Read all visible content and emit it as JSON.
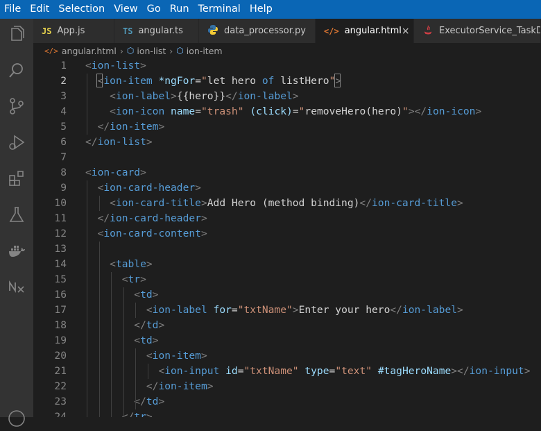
{
  "menu": [
    "File",
    "Edit",
    "Selection",
    "View",
    "Go",
    "Run",
    "Terminal",
    "Help"
  ],
  "tabs": [
    {
      "icon": "JS",
      "icon_color": "#e8d44d",
      "label": "App.js",
      "active": false
    },
    {
      "icon": "TS",
      "icon_color": "#519aba",
      "label": "angular.ts",
      "active": false
    },
    {
      "icon": "python-icon",
      "icon_color": "#3572a5",
      "label": "data_processor.py",
      "active": false
    },
    {
      "icon": "</>",
      "icon_color": "#e37933",
      "label": "angular.html",
      "active": true
    },
    {
      "icon": "java-icon",
      "icon_color": "#cc3e44",
      "label": "ExecutorService_TaskDepe",
      "active": false
    }
  ],
  "breadcrumb": [
    "angular.html",
    "ion-list",
    "ion-item"
  ],
  "editor": {
    "current_line": 2,
    "lines": [
      {
        "n": "1",
        "tokens": [
          [
            "p",
            "<"
          ],
          [
            "tag",
            "ion-list"
          ],
          [
            "p",
            ">"
          ]
        ]
      },
      {
        "n": "2",
        "tokens": [
          [
            "txt",
            "  "
          ],
          [
            "p",
            "<"
          ],
          [
            "tag",
            "ion-item"
          ],
          [
            "txt",
            " "
          ],
          [
            "attr",
            "*ngFor"
          ],
          [
            "txt",
            "="
          ],
          [
            "str",
            "\""
          ],
          [
            "txt",
            "let hero "
          ],
          [
            "tag",
            "of"
          ],
          [
            "txt",
            " listHero"
          ],
          [
            "str",
            "\""
          ],
          [
            "p",
            ">"
          ]
        ]
      },
      {
        "n": "3",
        "tokens": [
          [
            "txt",
            "    "
          ],
          [
            "p",
            "<"
          ],
          [
            "tag",
            "ion-label"
          ],
          [
            "p",
            ">"
          ],
          [
            "txt",
            "{{hero}}"
          ],
          [
            "p",
            "</"
          ],
          [
            "tag",
            "ion-label"
          ],
          [
            "p",
            ">"
          ]
        ]
      },
      {
        "n": "4",
        "tokens": [
          [
            "txt",
            "    "
          ],
          [
            "p",
            "<"
          ],
          [
            "tag",
            "ion-icon"
          ],
          [
            "txt",
            " "
          ],
          [
            "attr",
            "name"
          ],
          [
            "txt",
            "="
          ],
          [
            "str",
            "\"trash\""
          ],
          [
            "txt",
            " "
          ],
          [
            "attr",
            "(click)"
          ],
          [
            "txt",
            "="
          ],
          [
            "str",
            "\""
          ],
          [
            "txt",
            "removeHero(hero)"
          ],
          [
            "str",
            "\""
          ],
          [
            "p",
            "></"
          ],
          [
            "tag",
            "ion-icon"
          ],
          [
            "p",
            ">"
          ]
        ]
      },
      {
        "n": "5",
        "tokens": [
          [
            "txt",
            "  "
          ],
          [
            "p",
            "</"
          ],
          [
            "tag",
            "ion-item"
          ],
          [
            "p",
            ">"
          ]
        ]
      },
      {
        "n": "6",
        "tokens": [
          [
            "p",
            "</"
          ],
          [
            "tag",
            "ion-list"
          ],
          [
            "p",
            ">"
          ]
        ]
      },
      {
        "n": "7",
        "tokens": []
      },
      {
        "n": "8",
        "tokens": [
          [
            "p",
            "<"
          ],
          [
            "tag",
            "ion-card"
          ],
          [
            "p",
            ">"
          ]
        ]
      },
      {
        "n": "9",
        "tokens": [
          [
            "txt",
            "  "
          ],
          [
            "p",
            "<"
          ],
          [
            "tag",
            "ion-card-header"
          ],
          [
            "p",
            ">"
          ]
        ]
      },
      {
        "n": "10",
        "tokens": [
          [
            "txt",
            "    "
          ],
          [
            "p",
            "<"
          ],
          [
            "tag",
            "ion-card-title"
          ],
          [
            "p",
            ">"
          ],
          [
            "txt",
            "Add Hero (method binding)"
          ],
          [
            "p",
            "</"
          ],
          [
            "tag",
            "ion-card-title"
          ],
          [
            "p",
            ">"
          ]
        ]
      },
      {
        "n": "11",
        "tokens": [
          [
            "txt",
            "  "
          ],
          [
            "p",
            "</"
          ],
          [
            "tag",
            "ion-card-header"
          ],
          [
            "p",
            ">"
          ]
        ]
      },
      {
        "n": "12",
        "tokens": [
          [
            "txt",
            "  "
          ],
          [
            "p",
            "<"
          ],
          [
            "tag",
            "ion-card-content"
          ],
          [
            "p",
            ">"
          ]
        ]
      },
      {
        "n": "13",
        "tokens": []
      },
      {
        "n": "14",
        "tokens": [
          [
            "txt",
            "    "
          ],
          [
            "p",
            "<"
          ],
          [
            "tag",
            "table"
          ],
          [
            "p",
            ">"
          ]
        ]
      },
      {
        "n": "15",
        "tokens": [
          [
            "txt",
            "      "
          ],
          [
            "p",
            "<"
          ],
          [
            "tag",
            "tr"
          ],
          [
            "p",
            ">"
          ]
        ]
      },
      {
        "n": "16",
        "tokens": [
          [
            "txt",
            "        "
          ],
          [
            "p",
            "<"
          ],
          [
            "tag",
            "td"
          ],
          [
            "p",
            ">"
          ]
        ]
      },
      {
        "n": "17",
        "tokens": [
          [
            "txt",
            "          "
          ],
          [
            "p",
            "<"
          ],
          [
            "tag",
            "ion-label"
          ],
          [
            "txt",
            " "
          ],
          [
            "attr",
            "for"
          ],
          [
            "txt",
            "="
          ],
          [
            "str",
            "\"txtName\""
          ],
          [
            "p",
            ">"
          ],
          [
            "txt",
            "Enter your hero"
          ],
          [
            "p",
            "</"
          ],
          [
            "tag",
            "ion-label"
          ],
          [
            "p",
            ">"
          ]
        ]
      },
      {
        "n": "18",
        "tokens": [
          [
            "txt",
            "        "
          ],
          [
            "p",
            "</"
          ],
          [
            "tag",
            "td"
          ],
          [
            "p",
            ">"
          ]
        ]
      },
      {
        "n": "19",
        "tokens": [
          [
            "txt",
            "        "
          ],
          [
            "p",
            "<"
          ],
          [
            "tag",
            "td"
          ],
          [
            "p",
            ">"
          ]
        ]
      },
      {
        "n": "20",
        "tokens": [
          [
            "txt",
            "          "
          ],
          [
            "p",
            "<"
          ],
          [
            "tag",
            "ion-item"
          ],
          [
            "p",
            ">"
          ]
        ]
      },
      {
        "n": "21",
        "tokens": [
          [
            "txt",
            "            "
          ],
          [
            "p",
            "<"
          ],
          [
            "tag",
            "ion-input"
          ],
          [
            "txt",
            " "
          ],
          [
            "attr",
            "id"
          ],
          [
            "txt",
            "="
          ],
          [
            "str",
            "\"txtName\""
          ],
          [
            "txt",
            " "
          ],
          [
            "attr",
            "type"
          ],
          [
            "txt",
            "="
          ],
          [
            "str",
            "\"text\""
          ],
          [
            "txt",
            " "
          ],
          [
            "attr",
            "#tagHeroName"
          ],
          [
            "p",
            "></"
          ],
          [
            "tag",
            "ion-input"
          ],
          [
            "p",
            ">"
          ]
        ]
      },
      {
        "n": "22",
        "tokens": [
          [
            "txt",
            "          "
          ],
          [
            "p",
            "</"
          ],
          [
            "tag",
            "ion-item"
          ],
          [
            "p",
            ">"
          ]
        ]
      },
      {
        "n": "23",
        "tokens": [
          [
            "txt",
            "        "
          ],
          [
            "p",
            "</"
          ],
          [
            "tag",
            "td"
          ],
          [
            "p",
            ">"
          ]
        ]
      },
      {
        "n": "24",
        "tokens": [
          [
            "txt",
            "      "
          ],
          [
            "p",
            "</"
          ],
          [
            "tag",
            "tr"
          ],
          [
            "p",
            ">"
          ]
        ]
      }
    ]
  },
  "colors": {
    "menubar": "#0a66b5",
    "activity": "#333333",
    "editor": "#1e1e1e",
    "tag": "#569cd6",
    "attr": "#9cdcfe",
    "string": "#ce9178",
    "punct": "#808080"
  },
  "activity_icons": [
    "explorer-icon",
    "search-icon",
    "source-control-icon",
    "run-debug-icon",
    "extensions-icon",
    "testing-icon",
    "docker-icon",
    "nx-console-icon",
    "account-icon"
  ]
}
